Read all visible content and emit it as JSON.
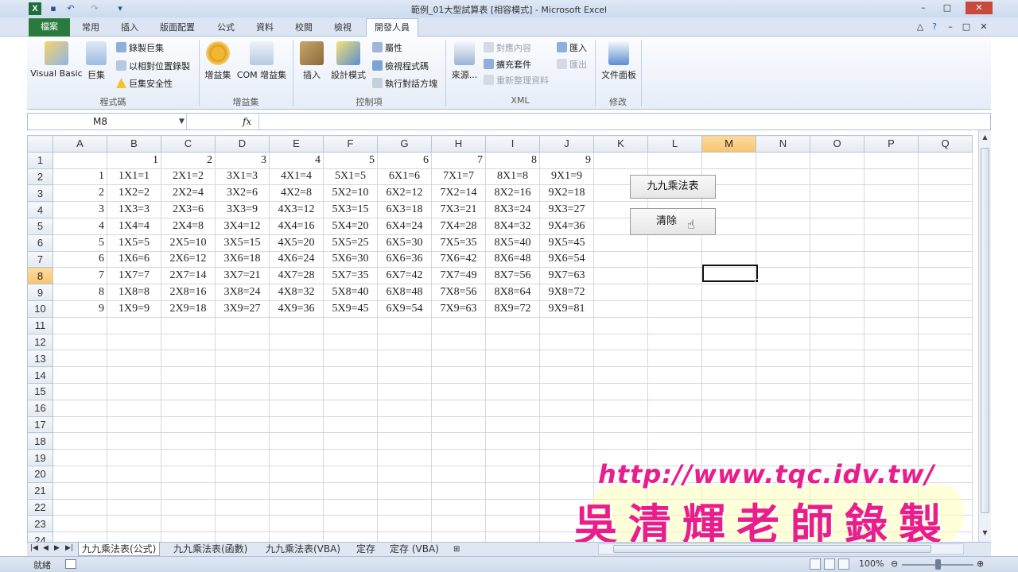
{
  "window": {
    "title": "範例_01大型試算表 [相容模式] - Microsoft Excel",
    "logo": "X",
    "winbtns": [
      "–",
      "□",
      "✕"
    ],
    "winbtns2": [
      "△",
      "?",
      "–",
      "□",
      "✕"
    ]
  },
  "ribbon_tabs": {
    "file": "檔案",
    "items": [
      "常用",
      "插入",
      "版面配置",
      "公式",
      "資料",
      "校閱",
      "檢視"
    ],
    "active": "開發人員"
  },
  "ribbon": {
    "groups": {
      "code": "程式碼",
      "addins": "增益集",
      "controls": "控制項",
      "xml": "XML",
      "modify": "修改"
    },
    "visual_basic": "Visual Basic",
    "macros": "巨集",
    "record_macro": "錄製巨集",
    "relative_ref": "以相對位置錄製",
    "macro_security": "巨集安全性",
    "addins_btn": "增益集",
    "com_addins": "COM 增益集",
    "insert": "插入",
    "design_mode": "設計模式",
    "properties": "屬性",
    "view_code": "檢視程式碼",
    "run_dialog": "執行對話方塊",
    "source": "來源...",
    "map_properties": "對應內容",
    "expansion_packs": "擴充套件",
    "refresh_data": "重新整理資料",
    "import": "匯入",
    "export": "匯出",
    "document_panel": "文件面板"
  },
  "formula_bar": {
    "name_box": "M8",
    "fx": "fx",
    "content": ""
  },
  "sheet": {
    "columns": [
      "A",
      "B",
      "C",
      "D",
      "E",
      "F",
      "G",
      "H",
      "I",
      "J",
      "K",
      "L",
      "M",
      "N",
      "O",
      "P",
      "Q"
    ],
    "selected_column": "M",
    "selected_row": 8,
    "selected_cell": "M8",
    "row_count": 24,
    "header_row": [
      "",
      "1",
      "2",
      "3",
      "4",
      "5",
      "6",
      "7",
      "8",
      "9"
    ],
    "rows": [
      [
        "1",
        "1X1=1",
        "2X1=2",
        "3X1=3",
        "4X1=4",
        "5X1=5",
        "6X1=6",
        "7X1=7",
        "8X1=8",
        "9X1=9"
      ],
      [
        "2",
        "1X2=2",
        "2X2=4",
        "3X2=6",
        "4X2=8",
        "5X2=10",
        "6X2=12",
        "7X2=14",
        "8X2=16",
        "9X2=18"
      ],
      [
        "3",
        "1X3=3",
        "2X3=6",
        "3X3=9",
        "4X3=12",
        "5X3=15",
        "6X3=18",
        "7X3=21",
        "8X3=24",
        "9X3=27"
      ],
      [
        "4",
        "1X4=4",
        "2X4=8",
        "3X4=12",
        "4X4=16",
        "5X4=20",
        "6X4=24",
        "7X4=28",
        "8X4=32",
        "9X4=36"
      ],
      [
        "5",
        "1X5=5",
        "2X5=10",
        "3X5=15",
        "4X5=20",
        "5X5=25",
        "6X5=30",
        "7X5=35",
        "8X5=40",
        "9X5=45"
      ],
      [
        "6",
        "1X6=6",
        "2X6=12",
        "3X6=18",
        "4X6=24",
        "5X6=30",
        "6X6=36",
        "7X6=42",
        "8X6=48",
        "9X6=54"
      ],
      [
        "7",
        "1X7=7",
        "2X7=14",
        "3X7=21",
        "4X7=28",
        "5X7=35",
        "6X7=42",
        "7X7=49",
        "8X7=56",
        "9X7=63"
      ],
      [
        "8",
        "1X8=8",
        "2X8=16",
        "3X8=24",
        "4X8=32",
        "5X8=40",
        "6X8=48",
        "7X8=56",
        "8X8=64",
        "9X8=72"
      ],
      [
        "9",
        "1X9=9",
        "2X9=18",
        "3X9=27",
        "4X9=36",
        "5X9=45",
        "6X9=54",
        "7X9=63",
        "8X9=72",
        "9X9=81"
      ]
    ]
  },
  "buttons": {
    "multiplication_table": "九九乘法表",
    "clear": "清除"
  },
  "sheet_tabs": {
    "items": [
      "九九乘法表(公式)",
      "九九乘法表(函數)",
      "九九乘法表(VBA)",
      "定存",
      "定存 (VBA)"
    ],
    "active_index": 0
  },
  "status": {
    "ready": "就緒",
    "zoom": "100%"
  },
  "watermark": {
    "url": "http://www.tqc.idv.tw/",
    "name": "吳清輝老師錄製"
  },
  "colors": {
    "file_tab": "#2a7a3d",
    "selected_header": "#f8c46f",
    "watermark": "#e91e8a"
  }
}
